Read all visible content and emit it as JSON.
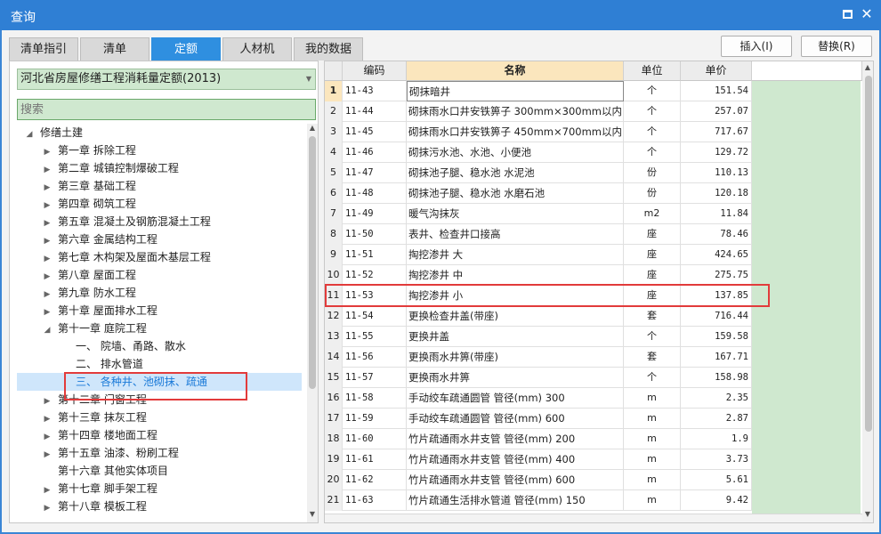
{
  "window": {
    "title": "查询"
  },
  "tabs": [
    {
      "label": "清单指引"
    },
    {
      "label": "清单"
    },
    {
      "label": "定额"
    },
    {
      "label": "人材机"
    },
    {
      "label": "我的数据"
    }
  ],
  "buttons": {
    "insert": "插入(I)",
    "replace": "替换(R)"
  },
  "library": {
    "selected": "河北省房屋修缮工程消耗量定额(2013)"
  },
  "search": {
    "placeholder": "搜索"
  },
  "tree": [
    {
      "label": "修缮土建",
      "level": 0,
      "state": "expanded"
    },
    {
      "label": "第一章 拆除工程",
      "level": 1,
      "state": "collapsed"
    },
    {
      "label": "第二章 城镇控制爆破工程",
      "level": 1,
      "state": "collapsed"
    },
    {
      "label": "第三章 基础工程",
      "level": 1,
      "state": "collapsed"
    },
    {
      "label": "第四章 砌筑工程",
      "level": 1,
      "state": "collapsed"
    },
    {
      "label": "第五章 混凝土及钢筋混凝土工程",
      "level": 1,
      "state": "collapsed"
    },
    {
      "label": "第六章 金属结构工程",
      "level": 1,
      "state": "collapsed"
    },
    {
      "label": "第七章 木构架及屋面木基层工程",
      "level": 1,
      "state": "collapsed"
    },
    {
      "label": "第八章 屋面工程",
      "level": 1,
      "state": "collapsed"
    },
    {
      "label": "第九章 防水工程",
      "level": 1,
      "state": "collapsed"
    },
    {
      "label": "第十章 屋面排水工程",
      "level": 1,
      "state": "collapsed"
    },
    {
      "label": "第十一章 庭院工程",
      "level": 1,
      "state": "expanded"
    },
    {
      "label": "一、 院墙、甬路、散水",
      "level": 2,
      "state": "leaf"
    },
    {
      "label": "二、 排水管道",
      "level": 2,
      "state": "leaf"
    },
    {
      "label": "三、 各种井、池砌抹、疏通",
      "level": 2,
      "state": "leaf",
      "selected": true
    },
    {
      "label": "第十二章 门窗工程",
      "level": 1,
      "state": "collapsed"
    },
    {
      "label": "第十三章 抹灰工程",
      "level": 1,
      "state": "collapsed"
    },
    {
      "label": "第十四章 楼地面工程",
      "level": 1,
      "state": "collapsed"
    },
    {
      "label": "第十五章 油漆、粉刷工程",
      "level": 1,
      "state": "collapsed"
    },
    {
      "label": "第十六章 其他实体项目",
      "level": 1,
      "state": "leaf"
    },
    {
      "label": "第十七章 脚手架工程",
      "level": 1,
      "state": "collapsed"
    },
    {
      "label": "第十八章 模板工程",
      "level": 1,
      "state": "collapsed"
    }
  ],
  "grid": {
    "headers": {
      "code": "编码",
      "name": "名称",
      "unit": "单位",
      "price": "单价"
    },
    "rows": [
      {
        "no": "1",
        "code": "11-43",
        "name": "砌抹暗井",
        "unit": "个",
        "price": "151.54"
      },
      {
        "no": "2",
        "code": "11-44",
        "name": "砌抹雨水口井安铁箅子 300mm×300mm以内",
        "unit": "个",
        "price": "257.07"
      },
      {
        "no": "3",
        "code": "11-45",
        "name": "砌抹雨水口井安铁箅子 450mm×700mm以内",
        "unit": "个",
        "price": "717.67"
      },
      {
        "no": "4",
        "code": "11-46",
        "name": "砌抹污水池、水池、小便池",
        "unit": "个",
        "price": "129.72"
      },
      {
        "no": "5",
        "code": "11-47",
        "name": "砌抹池子腿、稳水池 水泥池",
        "unit": "份",
        "price": "110.13"
      },
      {
        "no": "6",
        "code": "11-48",
        "name": "砌抹池子腿、稳水池 水磨石池",
        "unit": "份",
        "price": "120.18"
      },
      {
        "no": "7",
        "code": "11-49",
        "name": "暖气沟抹灰",
        "unit": "m2",
        "price": "11.84"
      },
      {
        "no": "8",
        "code": "11-50",
        "name": "表井、检查井口接高",
        "unit": "座",
        "price": "78.46"
      },
      {
        "no": "9",
        "code": "11-51",
        "name": "掏挖渗井 大",
        "unit": "座",
        "price": "424.65"
      },
      {
        "no": "10",
        "code": "11-52",
        "name": "掏挖渗井 中",
        "unit": "座",
        "price": "275.75"
      },
      {
        "no": "11",
        "code": "11-53",
        "name": "掏挖渗井 小",
        "unit": "座",
        "price": "137.85"
      },
      {
        "no": "12",
        "code": "11-54",
        "name": "更换检查井盖(带座)",
        "unit": "套",
        "price": "716.44"
      },
      {
        "no": "13",
        "code": "11-55",
        "name": "更换井盖",
        "unit": "个",
        "price": "159.58"
      },
      {
        "no": "14",
        "code": "11-56",
        "name": "更换雨水井箅(带座)",
        "unit": "套",
        "price": "167.71"
      },
      {
        "no": "15",
        "code": "11-57",
        "name": "更换雨水井箅",
        "unit": "个",
        "price": "158.98"
      },
      {
        "no": "16",
        "code": "11-58",
        "name": "手动绞车疏通圆管 管径(mm) 300",
        "unit": "m",
        "price": "2.35"
      },
      {
        "no": "17",
        "code": "11-59",
        "name": "手动绞车疏通圆管 管径(mm) 600",
        "unit": "m",
        "price": "2.87"
      },
      {
        "no": "18",
        "code": "11-60",
        "name": "竹片疏通雨水井支管 管径(mm) 200",
        "unit": "m",
        "price": "1.9"
      },
      {
        "no": "19",
        "code": "11-61",
        "name": "竹片疏通雨水井支管 管径(mm) 400",
        "unit": "m",
        "price": "3.73"
      },
      {
        "no": "20",
        "code": "11-62",
        "name": "竹片疏通雨水井支管 管径(mm) 600",
        "unit": "m",
        "price": "5.61"
      },
      {
        "no": "21",
        "code": "11-63",
        "name": "竹片疏通生活排水管道 管径(mm) 150",
        "unit": "m",
        "price": "9.42"
      }
    ]
  },
  "colors": {
    "accent": "#2f7fd4",
    "highlight": "#e23b3b",
    "selected_bg": "#cfe6fb",
    "green": "#cfe8cf"
  }
}
